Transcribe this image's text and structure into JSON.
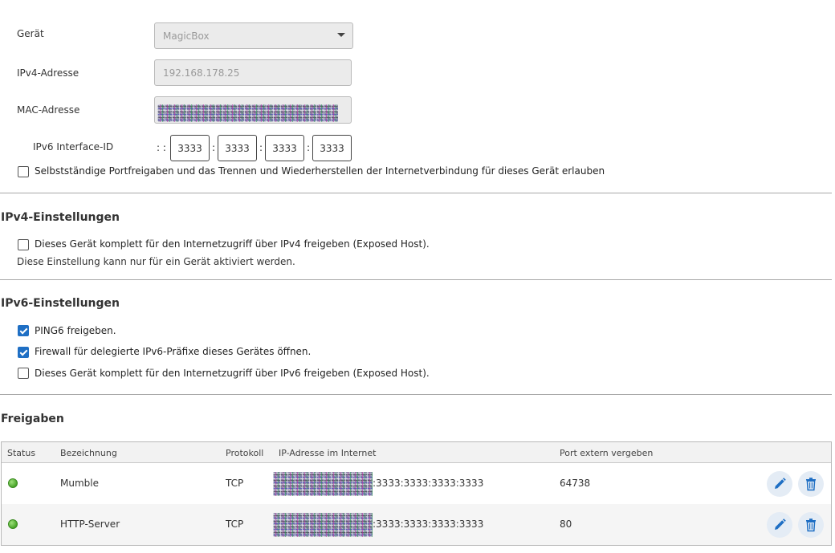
{
  "device": {
    "geraet_label": "Gerät",
    "geraet_value": "MagicBox",
    "ipv4_label": "IPv4-Adresse",
    "ipv4_value": "192.168.178.25",
    "mac_label": "MAC-Adresse",
    "ipv6_iid_label": "IPv6 Interface-ID",
    "ipv6_iid_prefix": ": :",
    "ipv6_iid_parts": [
      "3333",
      "3333",
      "3333",
      "3333"
    ],
    "ipv6_iid_sep": ":",
    "self_portfreigabe_label": "Selbstständige Portfreigaben und das Trennen und Wiederherstellen der Internetverbindung für dieses Gerät erlauben",
    "self_portfreigabe_checked": false
  },
  "ipv4_section": {
    "title": "IPv4-Einstellungen",
    "exposed_host_label": "Dieses Gerät komplett für den Internetzugriff über IPv4 freigeben (Exposed Host).",
    "exposed_host_checked": false,
    "note": "Diese Einstellung kann nur für ein Gerät aktiviert werden."
  },
  "ipv6_section": {
    "title": "IPv6-Einstellungen",
    "ping6_label": "PING6 freigeben.",
    "ping6_checked": true,
    "firewall_label": "Firewall für delegierte IPv6-Präfixe dieses Gerätes öffnen.",
    "firewall_checked": true,
    "exposed_host_label": "Dieses Gerät komplett für den Internetzugriff über IPv6 freigeben (Exposed Host).",
    "exposed_host_checked": false
  },
  "freigaben": {
    "title": "Freigaben",
    "columns": [
      "Status",
      "Bezeichnung",
      "Protokoll",
      "IP-Adresse im Internet",
      "Port extern vergeben"
    ],
    "rows": [
      {
        "status": "green",
        "name": "Mumble",
        "protocol": "TCP",
        "ip_suffix": ":3333:3333:3333:3333",
        "port": "64738"
      },
      {
        "status": "green",
        "name": "HTTP-Server",
        "protocol": "TCP",
        "ip_suffix": ":3333:3333:3333:3333",
        "port": "80"
      }
    ]
  },
  "colors": {
    "accent": "#1f6fc4",
    "status_green": "#4aa62a"
  },
  "icons": {
    "edit": "pencil-icon",
    "delete": "trash-icon",
    "dropdown": "chevron-down-icon"
  }
}
